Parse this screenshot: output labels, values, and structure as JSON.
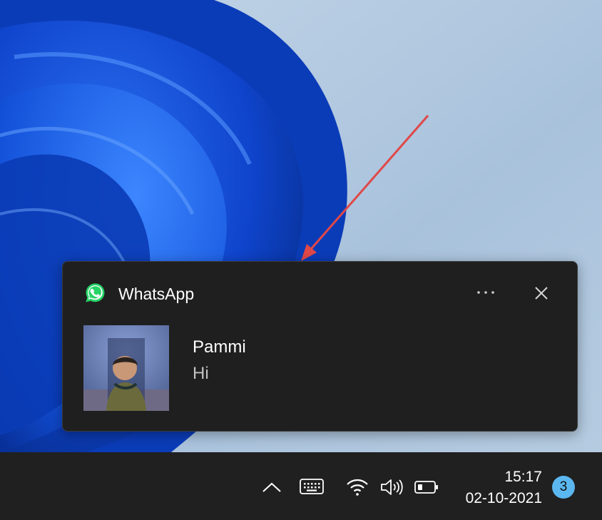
{
  "notification": {
    "app_name": "WhatsApp",
    "sender": "Pammi",
    "message": "Hi",
    "icons": {
      "app": "whatsapp-icon",
      "more": "more-options-icon",
      "close": "close-icon"
    }
  },
  "taskbar": {
    "time": "15:17",
    "date": "02-10-2021",
    "notification_count": "3",
    "icons": [
      "chevron-up-icon",
      "keyboard-icon",
      "wifi-icon",
      "speaker-icon",
      "battery-icon"
    ]
  },
  "colors": {
    "toast_background": "#1f1f1f",
    "taskbar_background": "#202020",
    "badge": "#5bb7ef",
    "annotation_arrow": "#e04848",
    "whatsapp_green": "#25d366"
  }
}
